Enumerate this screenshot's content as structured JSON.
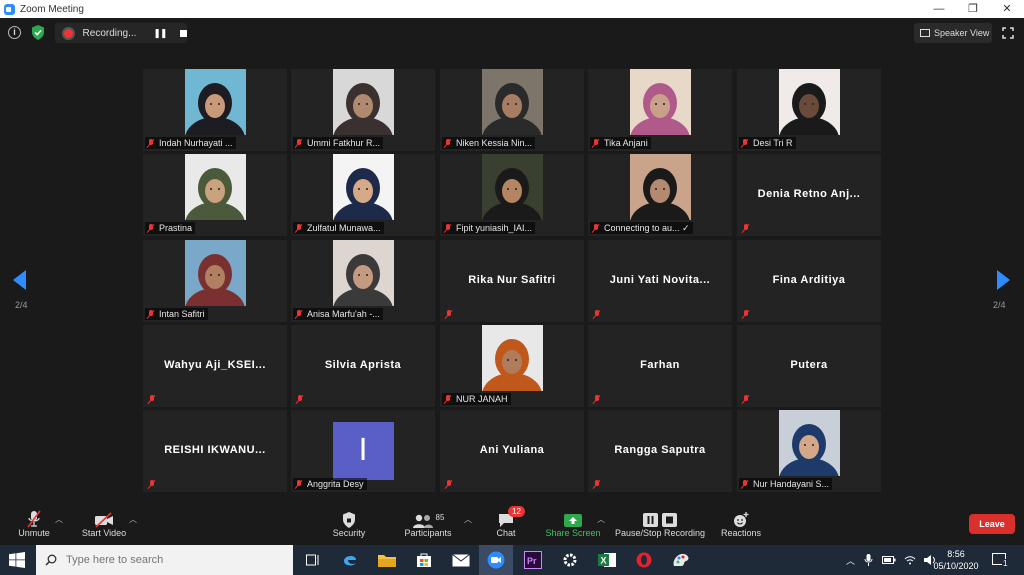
{
  "window": {
    "title": "Zoom Meeting",
    "controls": [
      "—",
      "❐",
      "✕"
    ]
  },
  "topbar": {
    "recording_label": "Recording...",
    "speaker_view_label": "Speaker View"
  },
  "pager": {
    "left": "2/4",
    "right": "2/4"
  },
  "participants": [
    {
      "name": "Indah Nurhayati ...",
      "video": true,
      "skin": "#c99a7a",
      "bg": "#6fb7d3",
      "hijab": "#1c1c22"
    },
    {
      "name": "Ummi Fatkhur R...",
      "video": true,
      "skin": "#b08a70",
      "bg": "#d8d8d8",
      "hijab": "#3a3030"
    },
    {
      "name": "Niken Kessia Nin...",
      "video": true,
      "skin": "#a67d63",
      "bg": "#7d756a",
      "hijab": "#2a2a2a"
    },
    {
      "name": "Tika Anjani",
      "video": true,
      "skin": "#c9a08a",
      "bg": "#e8d8c8",
      "hijab": "#b05a8c"
    },
    {
      "name": "Desi Tri R",
      "video": true,
      "skin": "#6a4a3a",
      "bg": "#f0ebe8",
      "hijab": "#1a1a1a"
    },
    {
      "name": "Prastina",
      "video": true,
      "skin": "#c9a27e",
      "bg": "#e9e9e9",
      "hijab": "#4a5a3a"
    },
    {
      "name": "Zulfatul Munawa...",
      "video": true,
      "skin": "#d6a988",
      "bg": "#f4f4f4",
      "hijab": "#1d2a4a"
    },
    {
      "name": "Fipit yuniasih_IAI...",
      "video": true,
      "skin": "#b58563",
      "bg": "#3a4030",
      "hijab": "#1a1a1a"
    },
    {
      "name": "Connecting to au... ✓",
      "video": true,
      "skin": "#b38a70",
      "bg": "#c9a38a",
      "hijab": "#1a1a1a"
    },
    {
      "name": "Denia Retno Anj...",
      "video": false
    },
    {
      "name": "Intan Safitri",
      "video": true,
      "skin": "#b08060",
      "bg": "#7aa8c8",
      "hijab": "#7a3030"
    },
    {
      "name": "Anisa Marfu'ah -...",
      "video": true,
      "skin": "#c49a80",
      "bg": "#ddd6d0",
      "hijab": "#3a3a3a"
    },
    {
      "name": "Rika Nur Safitri",
      "video": false
    },
    {
      "name": "Juni Yati Novita...",
      "video": false
    },
    {
      "name": "Fina Arditiya",
      "video": false
    },
    {
      "name": "Wahyu Aji_KSEI...",
      "video": false
    },
    {
      "name": "Silvia Aprista",
      "video": false
    },
    {
      "name": "NUR JANAH",
      "video": true,
      "skin": "#b07c5c",
      "bg": "#e8e8e8",
      "hijab": "#c0581c"
    },
    {
      "name": "Farhan",
      "video": false
    },
    {
      "name": "Putera",
      "video": false
    },
    {
      "name": "REISHI IKWANU...",
      "video": false
    },
    {
      "name": "Anggrita Desy",
      "video": true,
      "avatar_letter": "I",
      "avatar_color": "#5a5fc8"
    },
    {
      "name": "Ani Yuliana",
      "video": false
    },
    {
      "name": "Rangga Saputra",
      "video": false
    },
    {
      "name": "Nur Handayani S...",
      "video": true,
      "skin": "#d2a888",
      "bg": "#c9cfd8",
      "hijab": "#1e3a6a"
    }
  ],
  "toolbar": {
    "unmute": "Unmute",
    "start_video": "Start Video",
    "security": "Security",
    "participants_label": "Participants",
    "participants_count": "85",
    "chat": "Chat",
    "chat_badge": "12",
    "share_screen": "Share Screen",
    "pause_stop_recording": "Pause/Stop Recording",
    "reactions": "Reactions",
    "leave": "Leave"
  },
  "taskbar": {
    "search_placeholder": "Type here to search",
    "time": "8:56",
    "date": "05/10/2020",
    "notif_count": "1"
  },
  "colors": {
    "accent": "#2d8cff",
    "leave": "#d9302c",
    "share": "#2ea84f",
    "mute": "#e33333"
  }
}
